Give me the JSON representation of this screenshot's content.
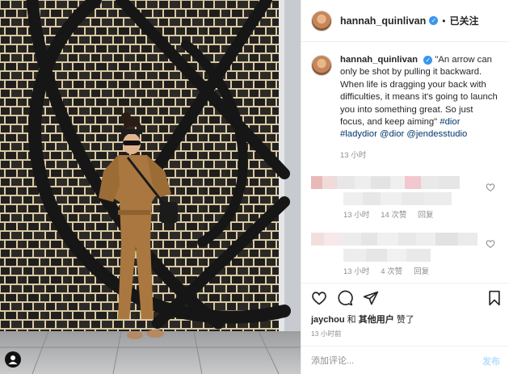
{
  "post": {
    "username": "hannah_quinlivan",
    "verified_icon": "verified-badge-icon",
    "separator": "•",
    "follow_state": "已关注"
  },
  "caption": {
    "username": "hannah_quinlivan",
    "text": "\"An arrow can only be shot by pulling it backward. When life is dragging your back with difficulties, it means it's going to launch you into something great. So just focus, and keep aiming\"",
    "tags": "#dior #ladydior @dior @jendesstudio",
    "time": "13 小时"
  },
  "replies": [
    {
      "time": "13 小时",
      "likes": "14 次赞",
      "reply_label": "回复"
    },
    {
      "time": "13 小时",
      "likes": "4 次赞",
      "reply_label": "回复"
    }
  ],
  "actions": {
    "icons": [
      "heart-icon",
      "comment-icon",
      "share-icon",
      "bookmark-icon"
    ],
    "liked_by_user": "jaychou",
    "liked_by_connector": "和",
    "liked_by_others": "其他用户",
    "liked_by_suffix": "赞了",
    "post_time": "13 小时前"
  },
  "comment_box": {
    "placeholder": "添加评论...",
    "post_label": "发布"
  },
  "colors": {
    "accent": "#3897f0",
    "link": "#00376b",
    "muted": "#8e8e8e",
    "post_disabled": "#b2dffc"
  }
}
